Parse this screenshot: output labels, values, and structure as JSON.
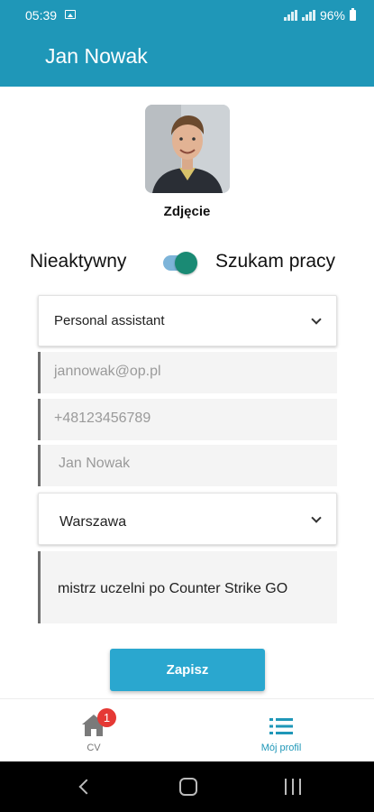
{
  "status_bar": {
    "time": "05:39",
    "battery": "96%"
  },
  "app_bar": {
    "title": "Jan Nowak"
  },
  "profile": {
    "photo_caption": "Zdjęcie",
    "status_inactive_label": "Nieaktywny",
    "status_active_label": "Szukam pracy",
    "job_seeking_enabled": true
  },
  "form": {
    "position_selected": "Personal assistant",
    "email": "jannowak@op.pl",
    "phone": "+48123456789",
    "name": "Jan Nowak",
    "city_selected": "Warszawa",
    "description": "mistrz uczelni po Counter Strike GO",
    "save_label": "Zapisz"
  },
  "bottom_nav": {
    "items": [
      {
        "label": "CV",
        "icon": "home-icon",
        "badge": "1",
        "active": false
      },
      {
        "label": "Mój profil",
        "icon": "list-icon",
        "active": true
      }
    ]
  },
  "colors": {
    "primary": "#1f97b8",
    "button": "#2aa7cf",
    "toggle_thumb": "#1a8a74",
    "badge": "#e53935"
  }
}
